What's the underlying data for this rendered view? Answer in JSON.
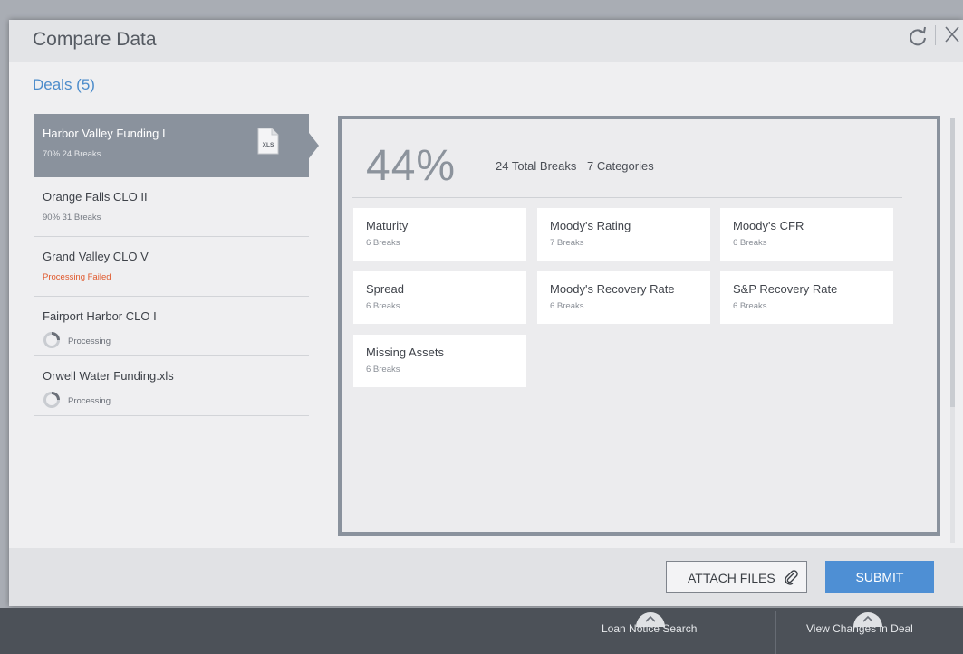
{
  "modal": {
    "title": "Compare Data",
    "deals_heading": "Deals (5)"
  },
  "deals": [
    {
      "name": "Harbor Valley Funding I",
      "meta": "70%  24 Breaks",
      "file_badge": "XLS"
    },
    {
      "name": "Orange Falls CLO II",
      "meta": "90%  31 Breaks"
    },
    {
      "name": "Grand Valley CLO V",
      "meta": "Processing Failed"
    },
    {
      "name": "Fairport Harbor CLO I",
      "meta": "Processing"
    },
    {
      "name": "Orwell Water Funding.xls",
      "meta": "Processing"
    }
  ],
  "detail": {
    "percent": "44%",
    "total_breaks": "24 Total Breaks",
    "categories_count": "7 Categories",
    "categories": [
      {
        "name": "Maturity",
        "breaks": "6 Breaks"
      },
      {
        "name": "Moody's Rating",
        "breaks": "7 Breaks"
      },
      {
        "name": "Moody's CFR",
        "breaks": "6 Breaks"
      },
      {
        "name": "Spread",
        "breaks": "6 Breaks"
      },
      {
        "name": "Moody's Recovery Rate",
        "breaks": "6 Breaks"
      },
      {
        "name": "S&P Recovery Rate",
        "breaks": "6 Breaks"
      },
      {
        "name": "Missing Assets",
        "breaks": "6 Breaks"
      }
    ]
  },
  "footer": {
    "attach_label": "ATTACH FILES",
    "submit_label": "SUBMIT"
  },
  "bottom_bar": {
    "tabs": [
      "Loan Notice Search",
      "View Changes in Deal"
    ]
  },
  "colors": {
    "accent": "#4e8fd4",
    "failed": "#e0582c",
    "selected": "#8a929d"
  },
  "icons": [
    "refresh-icon",
    "close-icon",
    "xls-file-icon",
    "spinner-icon",
    "paperclip-icon",
    "chevron-up-icon"
  ]
}
